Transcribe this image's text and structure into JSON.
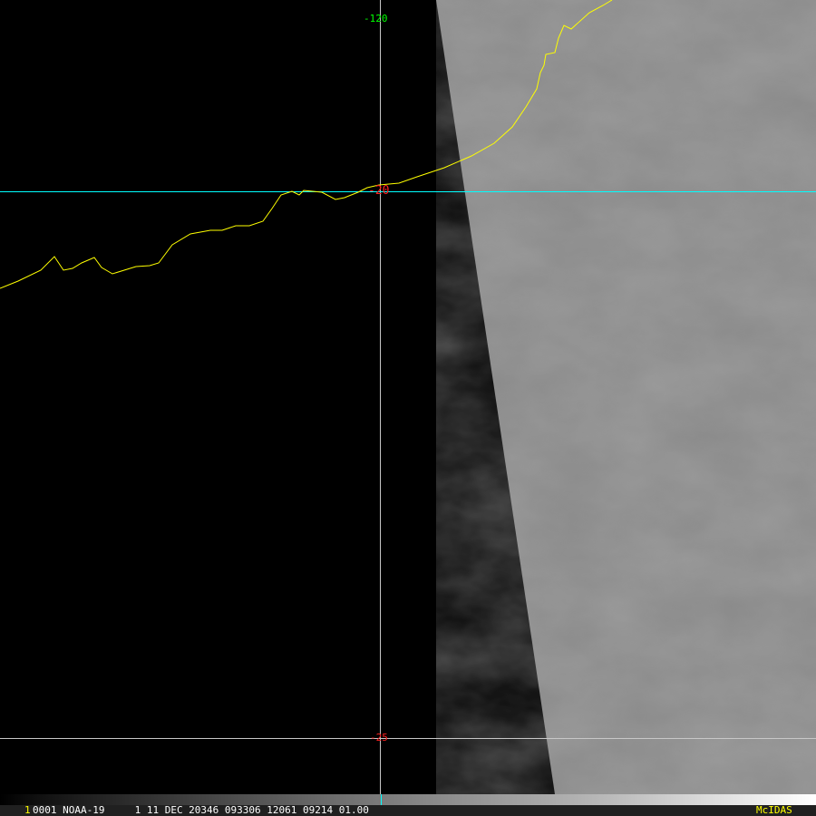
{
  "map": {
    "lon_label": "-120",
    "lat_labels": [
      "-20",
      "-25"
    ],
    "colors": {
      "lon_label": "#00ff00",
      "lat_label": "#ff2020",
      "coast": "#ffff00",
      "highlight_line": "#00ffff",
      "grid": "#c8c8c8"
    }
  },
  "status_bar": {
    "frame_number": "1",
    "info": "0001 NOAA-19     1 11 DEC 20346 093306 12061 09214 01.00",
    "brand": "McIDAS"
  }
}
